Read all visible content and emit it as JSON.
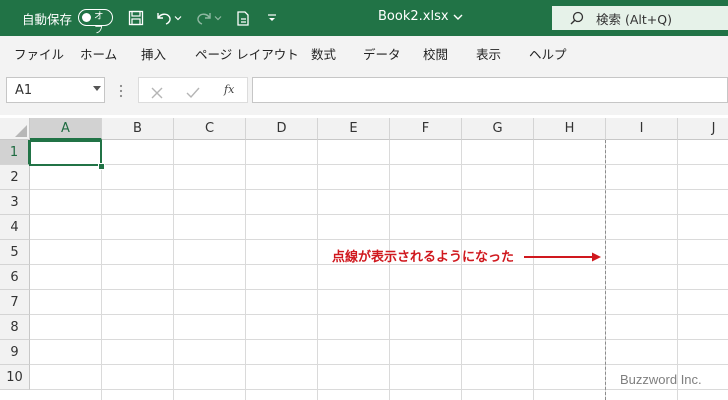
{
  "titlebar": {
    "autosave_label": "自動保存",
    "toggle_text": "オフ",
    "filename": "Book2.xlsx",
    "search_label": "検索 (Alt+Q)",
    "bg_color": "#217346"
  },
  "ribbon": {
    "tabs": [
      "ファイル",
      "ホーム",
      "挿入",
      "ページ レイアウト",
      "数式",
      "データ",
      "校閲",
      "表示",
      "ヘルプ"
    ]
  },
  "formula_bar": {
    "name_box": "A1",
    "formula": ""
  },
  "grid": {
    "columns": [
      "A",
      "B",
      "C",
      "D",
      "E",
      "F",
      "G",
      "H",
      "I",
      "J"
    ],
    "rows": [
      "1",
      "2",
      "3",
      "4",
      "5",
      "6",
      "7",
      "8",
      "9",
      "10"
    ],
    "active_cell": "A1"
  },
  "annotation": {
    "text": "点線が表示されるようになった",
    "color": "#d0181e"
  },
  "watermark": "Buzzword Inc."
}
